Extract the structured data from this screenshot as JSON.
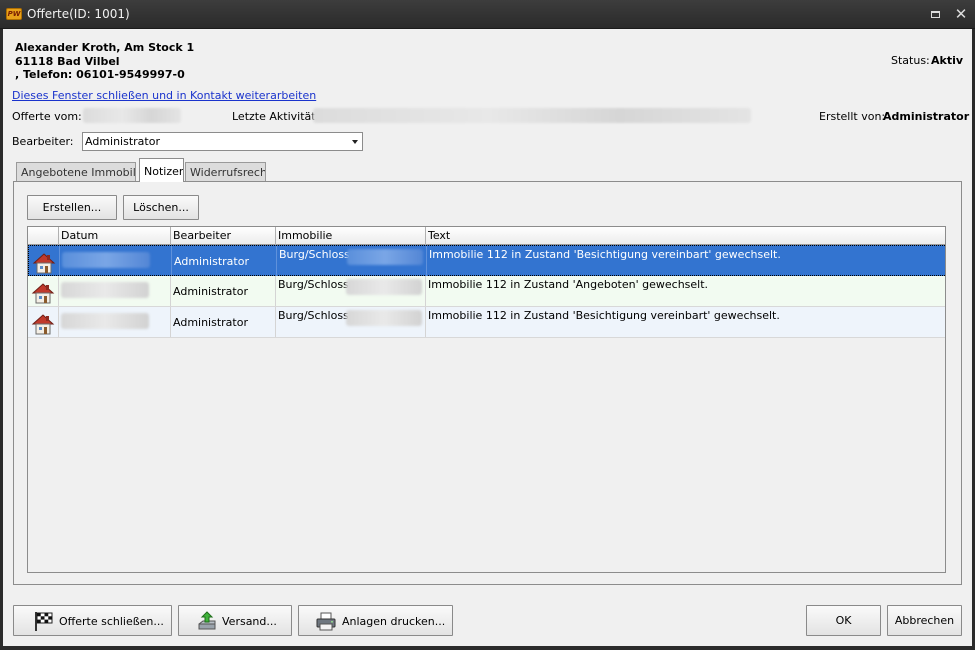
{
  "window": {
    "title": "Offerte(ID: 1001)",
    "logo_text": "PW"
  },
  "header": {
    "address_line1": "Alexander Kroth, Am Stock 1",
    "address_line2": "61118 Bad Vilbel",
    "address_line3": ", Telefon: 06101-9549997-0",
    "status_label": "Status:",
    "status_value": "Aktiv",
    "contact_link": "Dieses Fenster schließen und in Kontakt weiterarbeiten"
  },
  "info": {
    "offerte_vom_label": "Offerte vom:",
    "letzte_aktivitaet_label": "Letzte Aktivität:",
    "erstellt_von_label": "Erstellt von:",
    "erstellt_von_value": "Administrator",
    "bearbeiter_label": "Bearbeiter:",
    "bearbeiter_value": "Administrator"
  },
  "tabs": [
    {
      "label": "Angebotene Immobilien",
      "active": false
    },
    {
      "label": "Notizen",
      "active": true
    },
    {
      "label": "Widerrufsrecht",
      "active": false
    }
  ],
  "notes": {
    "create_button": "Erstellen...",
    "delete_button": "Löschen...",
    "columns": [
      "Datum",
      "Bearbeiter",
      "Immobilie",
      "Text"
    ],
    "rows": [
      {
        "bearbeiter": "Administrator",
        "immobilie": "Burg/Schloss,",
        "text": "Immobilie 112 in Zustand 'Besichtigung vereinbart' gewechselt.",
        "icon": "house-icon",
        "selected": true
      },
      {
        "bearbeiter": "Administrator",
        "immobilie": "Burg/Schloss,",
        "text": "Immobilie 112 in Zustand 'Angeboten' gewechselt.",
        "icon": "house-icon",
        "selected": false
      },
      {
        "bearbeiter": "Administrator",
        "immobilie": "Burg/Schloss,",
        "text": "Immobilie 112 in Zustand 'Besichtigung vereinbart' gewechselt.",
        "icon": "house-icon",
        "selected": false
      }
    ]
  },
  "footer": {
    "close_offer_button": "Offerte schließen...",
    "close_offer_icon": "checkered-flag-icon",
    "send_button": "Versand...",
    "send_icon": "send-tray-icon",
    "print_button": "Anlagen drucken...",
    "print_icon": "printer-icon",
    "ok_button": "OK",
    "cancel_button": "Abbrechen"
  },
  "colors": {
    "selection": "#3374d0",
    "link": "#1a33cc",
    "titlebar": "#2f2f2f"
  }
}
